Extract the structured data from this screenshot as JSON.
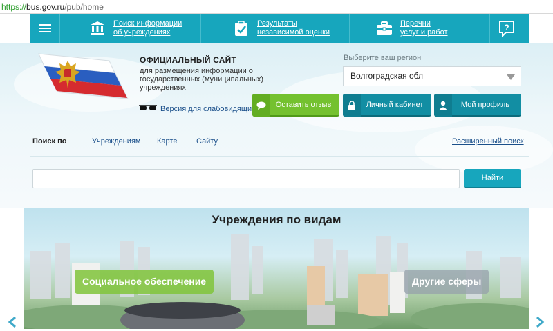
{
  "browser": {
    "url_protocol": "https://",
    "url_host": "bus.gov.ru",
    "url_path": "/pub/home"
  },
  "topnav": {
    "items": [
      {
        "line1": "Поиск информации",
        "line2": "об учреждениях"
      },
      {
        "line1": "Результаты",
        "line2": "независимой оценки"
      },
      {
        "line1": "Перечни",
        "line2": "услуг и работ"
      }
    ]
  },
  "header": {
    "title": "ОФИЦИАЛЬНЫЙ САЙТ",
    "subtitle": "для размещения информации о государственных (муниципальных) учреждениях",
    "vision_link": "Версия для слабовидящих"
  },
  "region": {
    "label": "Выберите ваш регион",
    "selected": "Волгоградская обл"
  },
  "buttons": {
    "feedback": "Оставить отзыв",
    "cabinet": "Личный кабинет",
    "profile": "Мой профиль"
  },
  "search": {
    "label": "Поиск по",
    "options": [
      "Учреждениям",
      "Карте",
      "Сайту"
    ],
    "advanced": "Расширенный поиск",
    "placeholder": "",
    "submit": "Найти"
  },
  "institutions": {
    "title": "Учреждения по видам",
    "categories": [
      "Социальное обеспечение",
      "Другие сферы"
    ]
  },
  "colors": {
    "accent": "#17a6bd",
    "green": "#74c12f",
    "dark_teal": "#128ea3"
  }
}
